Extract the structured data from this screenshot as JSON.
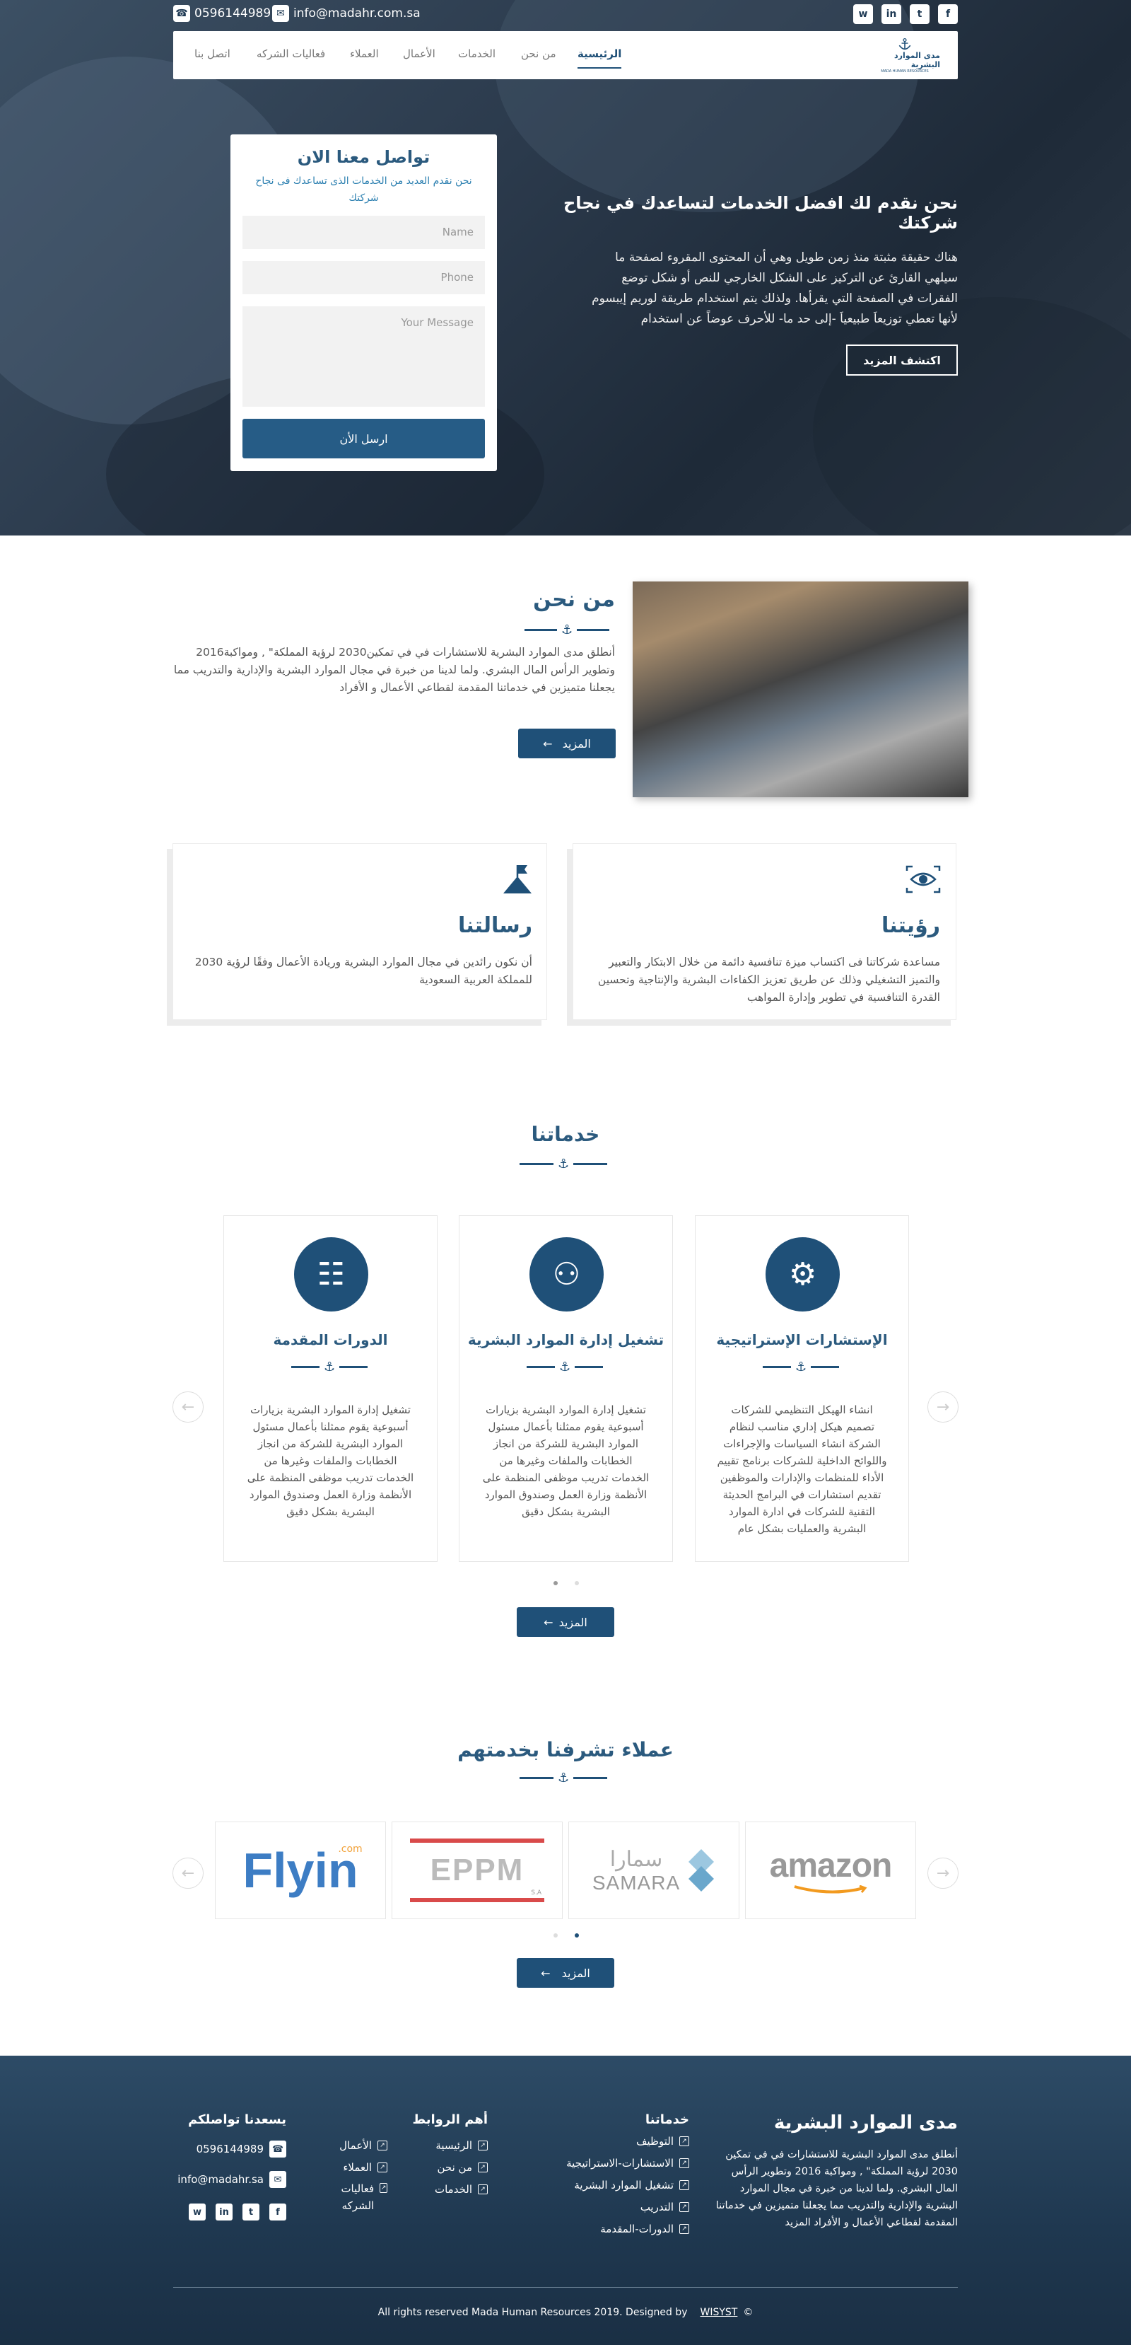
{
  "topbar": {
    "phone": "0596144989",
    "email": "info@madahr.com.sa",
    "social": [
      "f",
      "t",
      "in",
      "w"
    ]
  },
  "nav": {
    "items": [
      "الرئيسية",
      "من نحن",
      "الخدمات",
      "الأعمال",
      "العملاء",
      "فعاليات الشركه",
      "اتصل بنا"
    ],
    "logo_text": "مدى الموارد البشرية",
    "logo_sub": "MADA HUMAN RESOURCES"
  },
  "contact_form": {
    "title": "تواصل معنا الان",
    "subtitle": "نحن نقدم العديد من الخدمات الذى تساعدك فى نجاح شركتك",
    "name_placeholder": "Name",
    "phone_placeholder": "Phone",
    "message_placeholder": "Your Message",
    "submit": "ارسل الأن"
  },
  "hero": {
    "title": "نحن نقدم لك افضل الخدمات لتساعدك في نجاح شركتك",
    "text": "هناك حقيقة مثبتة منذ زمن طويل وهي أن المحتوى المقروء لصفحة ما سيلهي القارئ عن التركيز على الشكل الخارجي للنص أو شكل توضع الفقرات في الصفحة التي يقرأها. ولذلك يتم استخدام طريقة لوريم إيبسوم لأنها تعطي توزيعاَ طبيعياَ -إلى حد ما- للأحرف عوضاً عن استخدام",
    "button": "اكتشف المزيد"
  },
  "about": {
    "title": "من نحن",
    "text": "أنطلق مدى الموارد البشرية للاستشارات في في تمكين2030 لرؤية المملكة\" , ومواكبة2016 وتطوير الرأس المال البشري. ولما لدينا من خبرة في مجال الموارد البشرية والإدارية والتدريب مما يجعلنا متميزين في خدماتنا المقدمة لقطاعي الأعمال و الأفراد",
    "button": "المزيد"
  },
  "vision": {
    "title": "رؤيتنا",
    "text": "مساعدة شركاتنا فى اكتساب ميزة تنافسية دائمة من خلال الابتكار والتعبير والتميز التشغيلي وذلك عن طريق تعزيز الكفاءات البشرية والإنتاجية وتحسين القدرة التنافسية في تطوير وإدارة المواهب"
  },
  "mission": {
    "title": "رسالتنا",
    "text": "أن نكون رائدين في مجال الموارد البشرية وريادة الأعمال وفقًا لرؤية 2030 للمملكة العربية السعودية"
  },
  "services": {
    "title": "خدماتنا",
    "button": "المزيد",
    "items": [
      {
        "title": "الإستشارات الإستراتيجية",
        "text": "انشاء الهيكل التنظيمي للشركات تصميم هيكل إداري مناسب لنظام الشركة انشاء السياسات والإجراءات واللوائح الداخلية للشركات برنامج تقييم الأداء للمنظمات والإدارات والموظفين تقديم استشارات في البرامج الحديثة التقنية للشركات في ادارة الموارد البشرية والعمليات بشكل عام"
      },
      {
        "title": "تشغيل إدارة الموارد البشرية",
        "text": "تشغيل إدارة الموارد البشرية بزيارات أسبوعية يقوم ممثلنا بأعمال مسئول الموارد البشرية للشركة من انجاز الخطابات والملفات وغيرها من الخدمات تدريب موظفى المنظمة على الأنظمة وزارة العمل وصندوق الموارد البشرية بشكل دقيق"
      },
      {
        "title": "الدورات المقدمة",
        "text": "تشغيل إدارة الموارد البشرية بزيارات أسبوعية يقوم ممثلنا بأعمال مسئول الموارد البشرية للشركة من انجاز الخطابات والملفات وغيرها من الخدمات تدريب موظفى المنظمة على الأنظمة وزارة العمل وصندوق الموارد البشرية بشكل دقيق"
      }
    ]
  },
  "clients": {
    "title": "عملاء تشرفنا بخدمتهم",
    "button": "المزيد",
    "logos": [
      "amazon",
      "SAMARA",
      "EPPM",
      "Flyin",
      ".com",
      "S.A",
      "سمارا"
    ]
  },
  "footer": {
    "brand_title": "مدى الموارد البشرية",
    "brand_text": "أنطلق مدى الموارد البشرية للاستشارات في في تمكين 2030 لرؤية المملكة\" , ومواكبة 2016 وتطوير الرأس المال البشري. ولما لدينا من خبرة في مجال الموارد البشرية والإدارية والتدريب مما يجعلنا متميزين في خدماتنا المقدمة لقطاعي الأعمال و الأفراد المزيد",
    "services_title": "خدماتنا",
    "services_links": [
      "التوظيف",
      "الاستشارات-الاستراتيجية",
      "تشغيل الموارد البشرية",
      "التدريب",
      "الدورات-المقدمة"
    ],
    "links_title": "أهم الروابط",
    "links_col1": [
      "الرئيسية",
      "من نحن",
      "الخدمات"
    ],
    "links_col2": [
      "الأعمال",
      "العملاء",
      "فعاليات الشركه"
    ],
    "contact_title": "يسعدنا تواصلكم",
    "phone": "0596144989",
    "email": "info@madahr.sa",
    "copyright": "All rights reserved Mada Human Resources 2019. Designed by",
    "designer": "WISYST",
    "copy_symbol": "©"
  }
}
